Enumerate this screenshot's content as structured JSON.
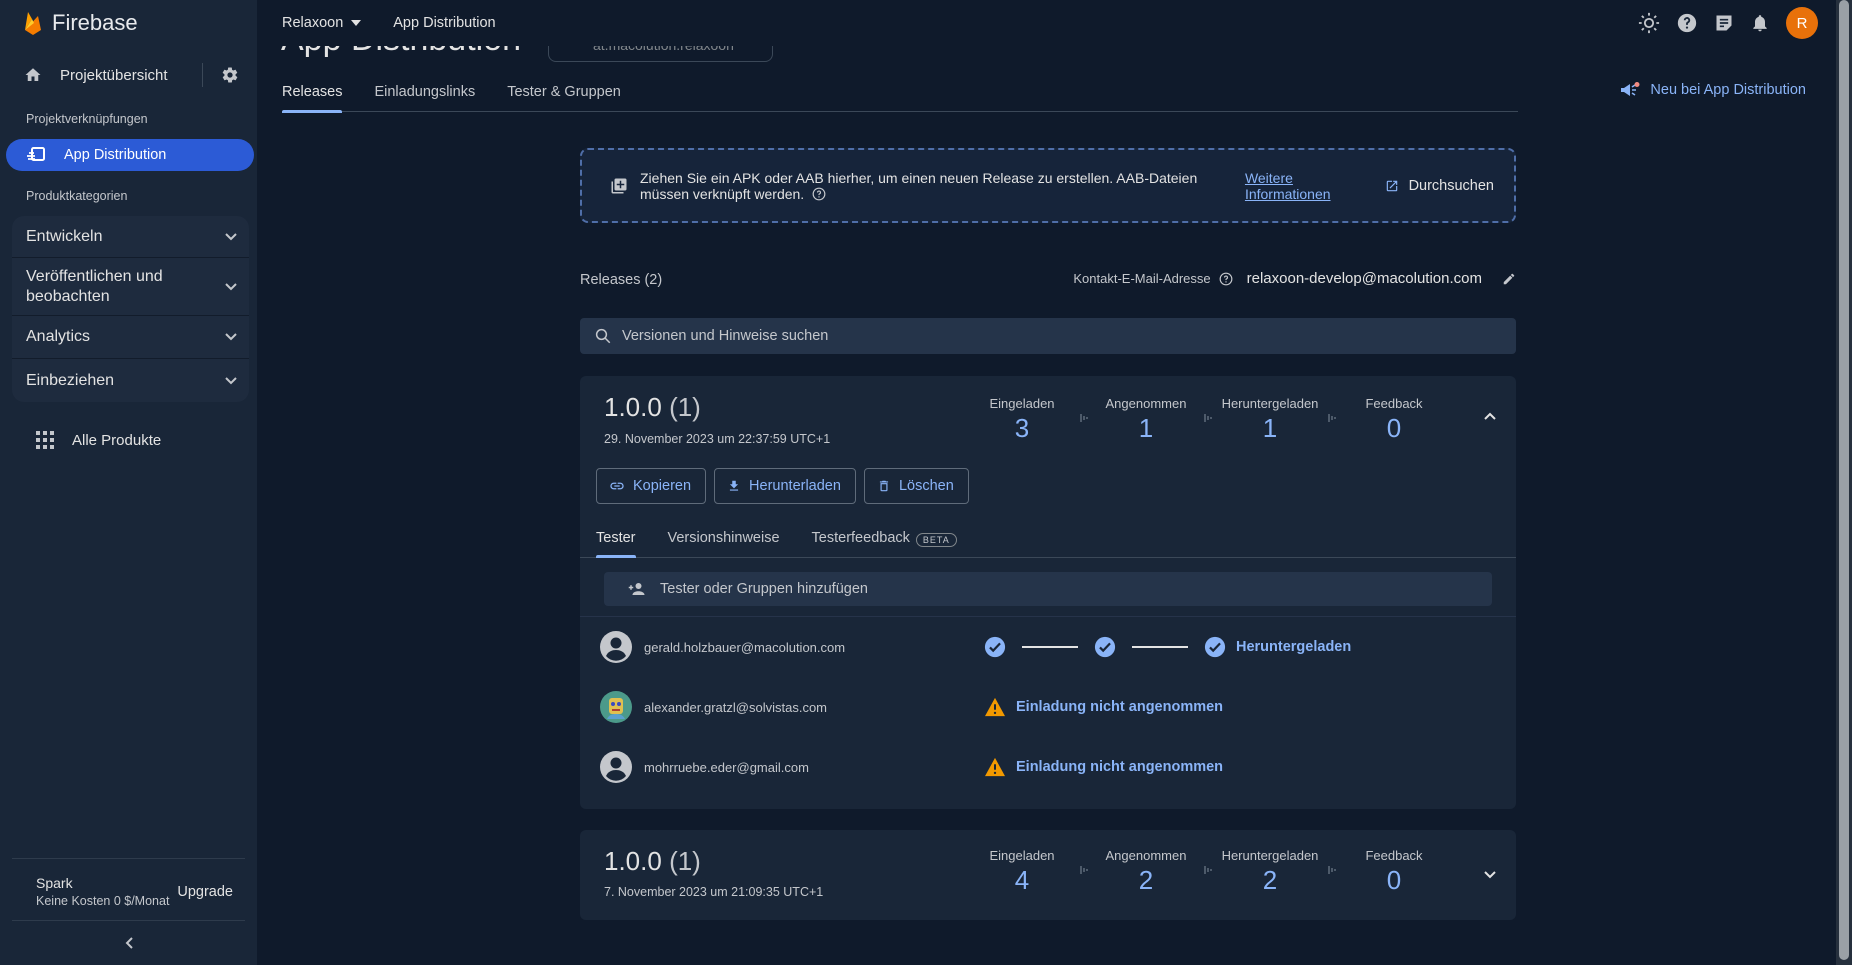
{
  "app": {
    "brand": "Firebase"
  },
  "topbar": {
    "project": "Relaxoon",
    "breadcrumb": "App Distribution",
    "avatar_letter": "R"
  },
  "sidebar": {
    "overview": "Projektübersicht",
    "shortcuts_label": "Projektverknüpfungen",
    "active_item": "App Distribution",
    "categories_label": "Produktkategorien",
    "categories": [
      "Entwickeln",
      "Veröffentlichen und beobachten",
      "Analytics",
      "Einbeziehen"
    ],
    "all_products": "Alle Produkte",
    "plan": {
      "name": "Spark",
      "cost": "Keine Kosten 0 $/Monat",
      "upgrade": "Upgrade"
    }
  },
  "page": {
    "title": "App Distribution",
    "app_selector": "at.macolution.relaxoon",
    "tabs": [
      "Releases",
      "Einladungslinks",
      "Tester & Gruppen"
    ],
    "news_link": "Neu bei App Distribution"
  },
  "dropzone": {
    "text": "Ziehen Sie ein APK oder AAB hierher, um einen neuen Release zu erstellen. AAB-Dateien müssen verknüpft werden.",
    "more_info": "Weitere Informationen",
    "browse": "Durchsuchen"
  },
  "releases": {
    "count_label": "Releases (2)",
    "contact_label": "Kontakt-E-Mail-Adresse",
    "contact_email": "relaxoon-develop@macolution.com",
    "search_placeholder": "Versionen und Hinweise suchen",
    "stat_labels": [
      "Eingeladen",
      "Angenommen",
      "Heruntergeladen",
      "Feedback"
    ],
    "items": [
      {
        "version": "1.0.0",
        "build": "(1)",
        "date": "29. November 2023 um 22:37:59 UTC+1",
        "stats": [
          "3",
          "1",
          "1",
          "0"
        ],
        "expanded": true
      },
      {
        "version": "1.0.0",
        "build": "(1)",
        "date": "7. November 2023 um 21:09:35 UTC+1",
        "stats": [
          "4",
          "2",
          "2",
          "0"
        ],
        "expanded": false
      }
    ],
    "actions": [
      "Kopieren",
      "Herunterladen",
      "Löschen"
    ],
    "detail_tabs": [
      "Tester",
      "Versionshinweise",
      "Testerfeedback"
    ],
    "beta_badge": "BETA",
    "add_tester_placeholder": "Tester oder Gruppen hinzufügen",
    "testers": [
      {
        "email": "gerald.holzbauer@macolution.com",
        "status": "Heruntergeladen",
        "state": "downloaded"
      },
      {
        "email": "alexander.gratzl@solvistas.com",
        "status": "Einladung nicht angenommen",
        "state": "pending"
      },
      {
        "email": "mohrruebe.eder@gmail.com",
        "status": "Einladung nicht angenommen",
        "state": "pending"
      }
    ]
  },
  "colors": {
    "accent": "#8ab4f8",
    "active_nav": "#2c5bd6",
    "warning": "#f29900",
    "avatar": "#e8710a",
    "background": "#0f1a2b"
  }
}
